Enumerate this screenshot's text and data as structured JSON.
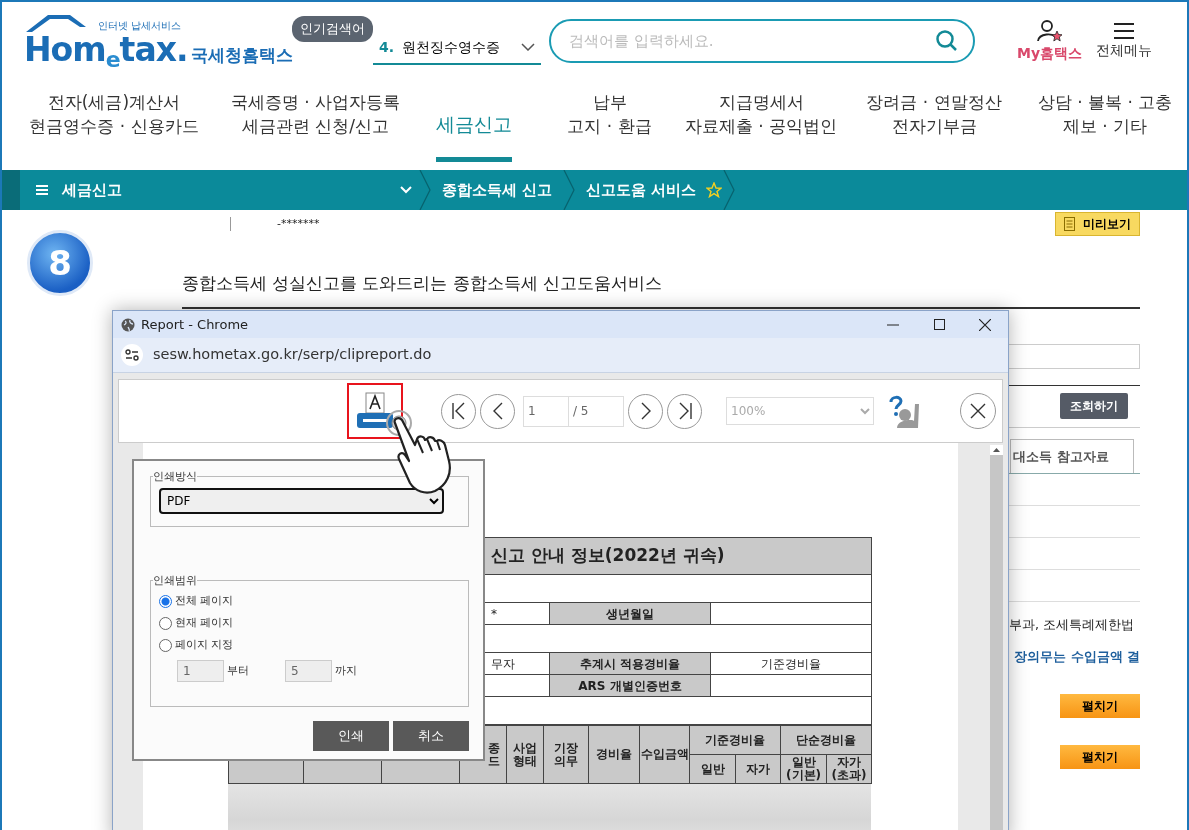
{
  "header": {
    "logo_subtitle": "인터넷 납세서비스",
    "logo_text": "Hom$_{e}$tax.",
    "logo_name": "국세청홈택스",
    "popular_label": "인기검색어",
    "popular_rank": "4.",
    "popular_term": "원천징수영수증",
    "search": {
      "placeholder": "검색어를 입력하세요."
    },
    "my_label": "My홈택스",
    "menu_label": "전체메뉴"
  },
  "nav": [
    {
      "label": "전자(세금)계산서\n현금영수증 · 신용카드",
      "selected": false
    },
    {
      "label": "국세증명 · 사업자등록\n세금관련 신청/신고",
      "selected": false
    },
    {
      "label": "세금신고",
      "selected": true
    },
    {
      "label": "납부\n고지 · 환급",
      "selected": false
    },
    {
      "label": "지급명세서\n자료제출 · 공익법인",
      "selected": false
    },
    {
      "label": "장려금 · 연말정산\n전자기부금",
      "selected": false
    },
    {
      "label": "상담 · 불복 · 고충\n제보 · 기타",
      "selected": false
    }
  ],
  "breadcrumb": {
    "menu": "세금신고",
    "items": [
      "종합소득세 신고",
      "신고도움 서비스"
    ],
    "favorite": false
  },
  "page": {
    "step": "8",
    "masked_id": "-*******",
    "preview_button": "미리보기",
    "heading": "종합소득세 성실신고를 도와드리는 종합소득세 신고도움서비스",
    "search_button": "조회하기",
    "tab": "대소득 참고자료",
    "note": "부과, 조세특례제한법",
    "note_link": "장의무는 수입금액 결",
    "expand_buttons": [
      "펼치기",
      "펼치기"
    ]
  },
  "popup": {
    "title": "Report - Chrome",
    "url": "sesw.hometax.go.kr/serp/clipreport.do",
    "toolbar": {
      "print_highlighted": true,
      "page": "1",
      "page_total": "/ 5",
      "zoom": "100%"
    },
    "report": {
      "title": "신고 안내 정보(2022년 귀속)",
      "info_rows": [
        {
          "kind": "blank"
        },
        {
          "kind": "field",
          "value": "*",
          "label": "생년월일"
        },
        {
          "kind": "blank"
        },
        {
          "kind": "field",
          "value": "무자",
          "label": "추계시 적용경비율",
          "value_2": "기준경비율"
        },
        {
          "kind": "field",
          "label": "ARS 개별인증번호"
        },
        {
          "kind": "blank"
        }
      ],
      "columns": [
        {
          "label": "종\n드"
        },
        {
          "label": "사업\n형태"
        },
        {
          "label": "기장\n의무"
        },
        {
          "label": "경비율"
        },
        {
          "label": "수입금액"
        },
        {
          "label": "기준경비율",
          "sub": [
            "일반",
            "자가"
          ]
        },
        {
          "label": "단순경비율",
          "sub": [
            "일반\n(기본)",
            "자가\n(초과)"
          ]
        }
      ]
    },
    "print_dialog": {
      "method_legend": "인쇄방식",
      "method": "PDF",
      "range_legend": "인쇄범위",
      "ranges": [
        {
          "label": "전체 페이지",
          "selected": true
        },
        {
          "label": "현재 페이지",
          "selected": false
        },
        {
          "label": "페이지 지정",
          "selected": false
        }
      ],
      "from": "1",
      "from_label": "부터",
      "to": "5",
      "to_label": "까지",
      "range_disabled": true,
      "buttons": [
        "인쇄",
        "취소"
      ]
    }
  }
}
